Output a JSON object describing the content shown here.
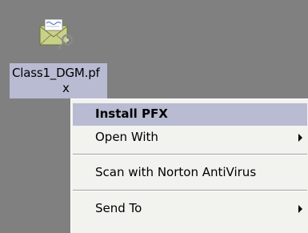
{
  "desktop": {
    "background": "#808080",
    "file": {
      "icon": "certificate-file-icon",
      "name_line1": "Class1_DGM.pf",
      "name_line2": "x"
    }
  },
  "context_menu": {
    "highlight_color": "#b9bbd3",
    "items": [
      {
        "label": "Install PFX",
        "bold": true,
        "highlighted": true,
        "submenu": false
      },
      {
        "label": "Open With",
        "bold": false,
        "highlighted": false,
        "submenu": true
      },
      {
        "label": "Scan with Norton AntiVirus",
        "bold": false,
        "highlighted": false,
        "submenu": false
      },
      {
        "label": "Send To",
        "bold": false,
        "highlighted": false,
        "submenu": true
      }
    ]
  }
}
